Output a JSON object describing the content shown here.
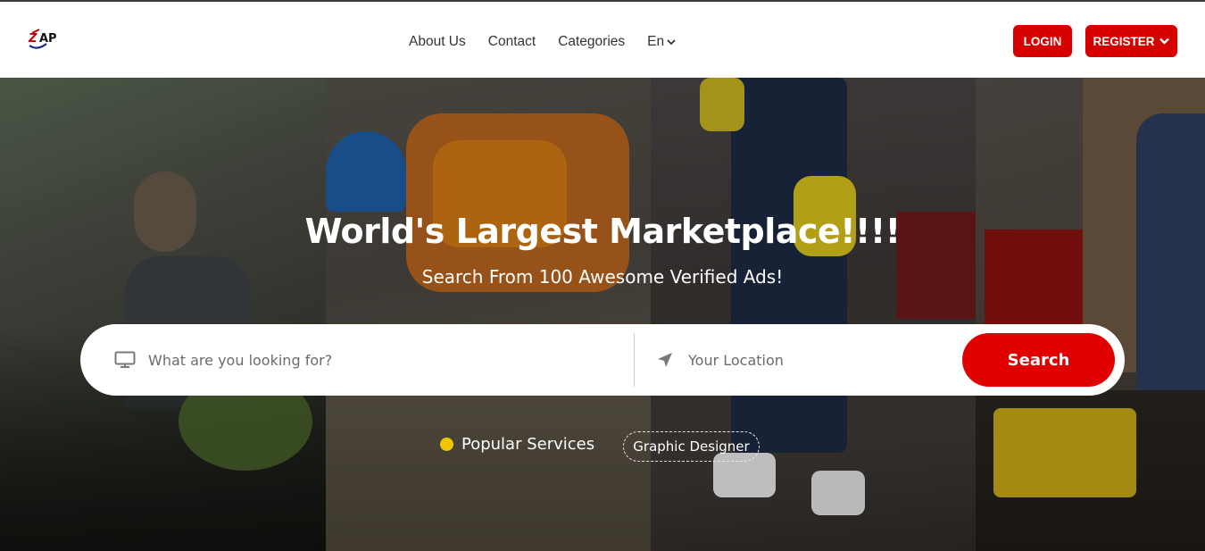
{
  "header": {
    "logo_text": "ZAP",
    "nav": [
      {
        "label": "About Us"
      },
      {
        "label": "Contact"
      },
      {
        "label": "Categories"
      }
    ],
    "language": "En",
    "login_label": "LOGIN",
    "register_label": "REGISTER"
  },
  "hero": {
    "title": "World's Largest Marketplace!!!!",
    "subtitle": "Search From 100 Awesome Verified Ads!",
    "search": {
      "what_placeholder": "What are you looking for?",
      "where_placeholder": "Your Location",
      "button_label": "Search"
    },
    "popular_label": "Popular Services",
    "popular_tags": [
      "Graphic Designer"
    ]
  },
  "colors": {
    "accent": "#d60000",
    "search_button": "#e00000",
    "dot": "#f0c600"
  },
  "icons": {
    "monitor": "monitor-icon",
    "location": "location-arrow-icon",
    "chevron": "chevron-down-icon"
  }
}
